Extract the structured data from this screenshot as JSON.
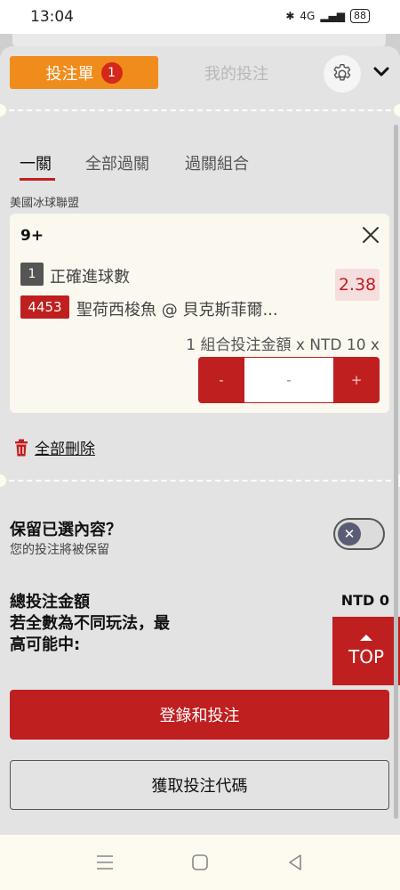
{
  "status_bar": {
    "time": "13:04",
    "network": "4G",
    "battery": "88"
  },
  "header": {
    "tab_betslip": "投注單",
    "betslip_count": "1",
    "tab_my_bets": "我的投注"
  },
  "subtabs": [
    "一關",
    "全部過關",
    "過關組合"
  ],
  "league": "美國冰球聯盟",
  "selection": {
    "label": "9+",
    "leg_number": "1",
    "market": "正確進球數",
    "odds": "2.38",
    "event_code": "4453",
    "match": "聖荷西梭魚 @ 貝克斯菲爾...",
    "combo_text": "1 組合投注金額 x NTD 10 x"
  },
  "stepper": {
    "minus": "-",
    "value": "-",
    "plus": "+"
  },
  "delete_all": "全部刪除",
  "keep": {
    "title": "保留已選內容？",
    "subtitle": "您的投注將被保留"
  },
  "totals": {
    "label": "總投注金額\n若全數為不同玩法，最高可能中:",
    "label_line1": "總投注金額",
    "label_line2": "若全數為不同玩法，最",
    "label_line3": "高可能中:",
    "value": "NTD 0"
  },
  "top_button": "TOP",
  "login_button": "登錄和投注",
  "code_button": "獲取投注代碼",
  "colors": {
    "accent_orange": "#f08c1c",
    "brand_red": "#c01f1f",
    "sheet_bg": "#e3e3e3"
  }
}
